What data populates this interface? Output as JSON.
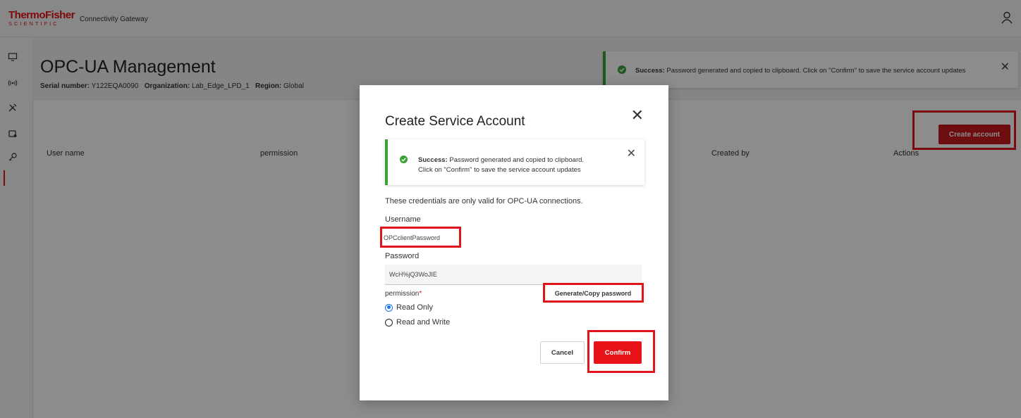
{
  "app": {
    "brand_main": "ThermoFisher",
    "brand_sub": "SCIENTIFIC",
    "product_name": "Connectivity Gateway"
  },
  "sidebar": {
    "items": [
      {
        "icon": "monitor-icon"
      },
      {
        "icon": "signal-icon"
      },
      {
        "icon": "tools-icon"
      },
      {
        "icon": "certificate-icon"
      },
      {
        "icon": "key-icon",
        "active": true
      }
    ]
  },
  "page": {
    "title": "OPC-UA Management",
    "serial_label": "Serial number:",
    "serial_value": "Y122EQA0090",
    "org_label": "Organization:",
    "org_value": "Lab_Edge_LPD_1",
    "region_label": "Region:",
    "region_value": "Global"
  },
  "toast": {
    "status": "Success:",
    "message": "Password generated and copied to clipboard. Click on \"Confirm\" to save the service account updates"
  },
  "actions": {
    "create_account": "Create account"
  },
  "table": {
    "columns": [
      "User name",
      "permission",
      "Created by",
      "Actions"
    ]
  },
  "modal": {
    "title": "Create Service Account",
    "toast_status": "Success:",
    "toast_line1": "Password generated and copied to clipboard.",
    "toast_line2": "Click on \"Confirm\" to save the service account updates",
    "info": "These credentials are only valid for OPC-UA connections.",
    "username_label": "Username",
    "username_value": "OPCclientPassword",
    "password_label": "Password",
    "password_value": "WcH%jQ3WoJIE",
    "permission_label": "permission",
    "required_mark": "*",
    "generate_button": "Generate/Copy password",
    "options": [
      "Read Only",
      "Read and Write"
    ],
    "selected_option": "Read Only",
    "cancel": "Cancel",
    "confirm": "Confirm"
  },
  "colors": {
    "brand_red": "#e71316",
    "success_green": "#3aa335",
    "highlight_red": "#e0151b",
    "radio_blue": "#1a73e8"
  }
}
